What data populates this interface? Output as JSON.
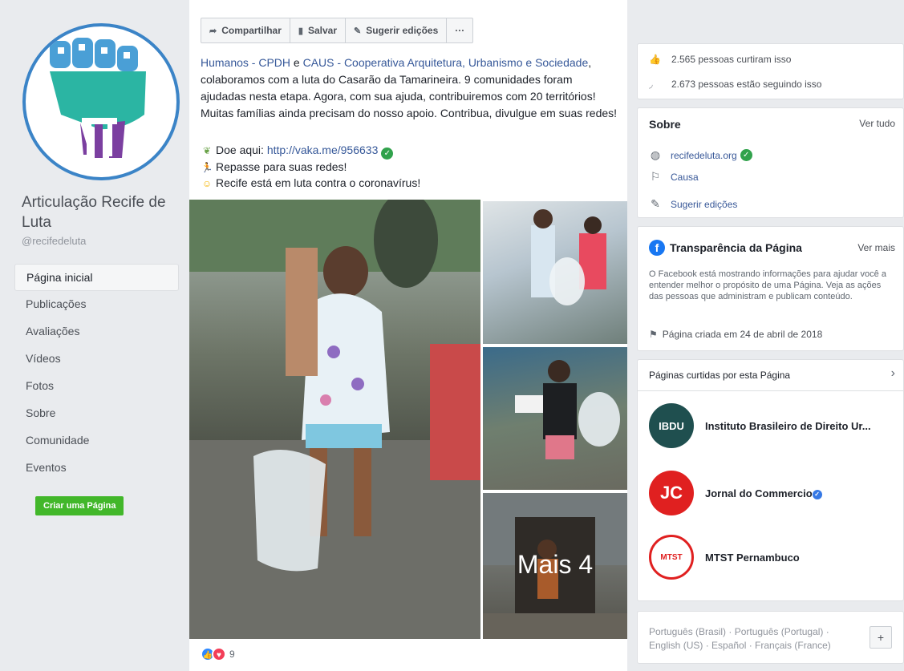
{
  "page": {
    "name": "Articulação Recife de Luta",
    "handle": "@recifedeluta"
  },
  "nav": [
    {
      "label": "Página inicial",
      "active": true
    },
    {
      "label": "Publicações"
    },
    {
      "label": "Avaliações"
    },
    {
      "label": "Vídeos"
    },
    {
      "label": "Fotos"
    },
    {
      "label": "Sobre"
    },
    {
      "label": "Comunidade"
    },
    {
      "label": "Eventos"
    }
  ],
  "create_page_label": "Criar uma Página",
  "actions": {
    "share": "Compartilhar",
    "save": "Salvar",
    "suggest": "Sugerir edições",
    "more": "···"
  },
  "post": {
    "link1": "Humanos - CPDH",
    "and": " e ",
    "link2": "CAUS - Cooperativa Arquitetura, Urbanismo e Sociedade",
    "body": ", colaboramos com a luta do Casarão da Tamarineira. 9 comunidades foram ajudadas nesta etapa. Agora, com sua ajuda, contribuiremos com 20 territórios! Muitas famílias ainda precisam do nosso apoio. Contribua, divulgue em suas redes!",
    "donate_prefix": "Doe aqui: ",
    "donate_link": "http://vaka.me/956633",
    "share_line": "Repasse para suas redes!",
    "fight_line": "Recife está em luta contra o coronavírus!",
    "more_photos": "Mais 4",
    "reaction_count": "9"
  },
  "stats": {
    "likes": "2.565 pessoas curtiram isso",
    "followers": "2.673 pessoas estão seguindo isso"
  },
  "about": {
    "title": "Sobre",
    "see_all": "Ver tudo",
    "website": "recifedeluta.org",
    "category": "Causa",
    "suggest": "Sugerir edições"
  },
  "transparency": {
    "title": "Transparência da Página",
    "see_more": "Ver mais",
    "description": "O Facebook está mostrando informações para ajudar você a entender melhor o propósito de uma Página. Veja as ações das pessoas que administram e publicam conteúdo.",
    "created": "Página criada em 24 de abril de 2018"
  },
  "liked_pages": {
    "title": "Páginas curtidas por esta Página",
    "items": [
      {
        "name": "Instituto Brasileiro de Direito Ur...",
        "logo": "IBDU",
        "color": "#1f4f4f"
      },
      {
        "name": "Jornal do Commercio",
        "logo": "JC",
        "color": "#e02020",
        "verified": true
      },
      {
        "name": "MTST Pernambuco",
        "logo": "MTST",
        "color": "#ffffff"
      }
    ]
  },
  "languages": {
    "text": "Português (Brasil) · Português (Portugal) · English (US) · Español · Français (France)",
    "add": "+"
  }
}
